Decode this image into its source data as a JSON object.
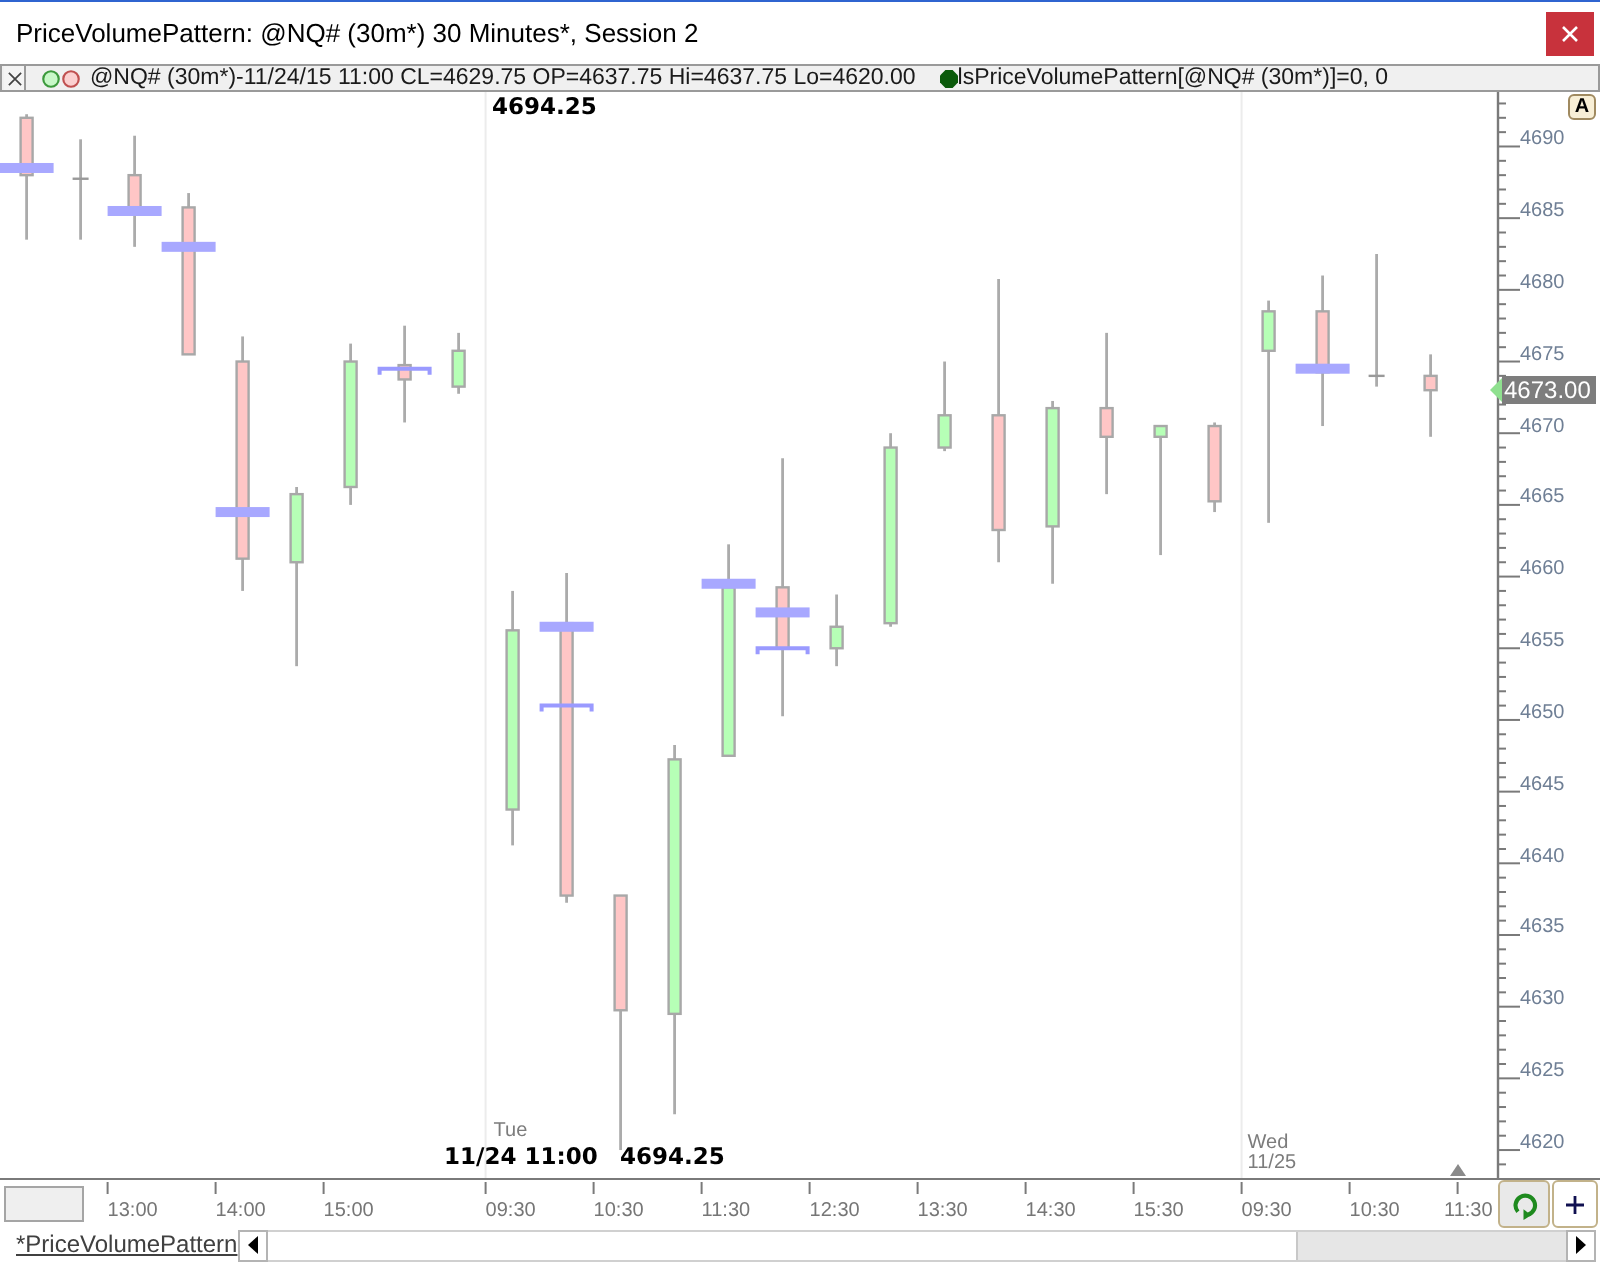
{
  "window": {
    "title": "PriceVolumePattern: @NQ# (30m*) 30 Minutes*, Session 2"
  },
  "data_bar": {
    "symbol_readout": "@NQ# (30m*)-11/24/15 11:00 CL=4629.75 OP=4637.75 Hi=4637.75 Lo=4620.00",
    "indicator_readout": "lsPriceVolumePattern[@NQ# (30m*)]=0, 0"
  },
  "chart": {
    "high_label": "4694.25",
    "cursor_time": "11/24 11:00",
    "cursor_price": "4694.25",
    "session_labels": [
      {
        "day": "Tue"
      },
      {
        "day": "Wed",
        "date": "11/25"
      }
    ],
    "last_price": "4673.00",
    "autoscale_button": "A",
    "chart_data": {
      "type": "candlestick",
      "categories": [
        null,
        null,
        "13:00",
        null,
        "14:00",
        null,
        "15:00",
        null,
        null,
        "09:30",
        null,
        "10:30",
        null,
        "11:30",
        null,
        "12:30",
        null,
        "13:30",
        null,
        "14:30",
        null,
        "15:30",
        null,
        "09:30",
        null,
        "10:30",
        null,
        "11:30"
      ],
      "ohlc": [
        [
          4692,
          4692.25,
          4683.5,
          4688
        ],
        [
          4687.75,
          4690.5,
          4683.5,
          4687.75
        ],
        [
          4688,
          4690.75,
          4683,
          4685.25
        ],
        [
          4685.75,
          4686.75,
          4675.5,
          4675.5
        ],
        [
          4675,
          4676.75,
          4659,
          4661.25
        ],
        [
          4661,
          4666.25,
          4653.75,
          4665.75
        ],
        [
          4666.25,
          4676.25,
          4665,
          4675
        ],
        [
          4674.75,
          4677.5,
          4670.75,
          4673.75
        ],
        [
          4673.25,
          4677,
          4672.75,
          4675.75
        ],
        [
          4643.75,
          4659,
          4641.25,
          4656.25
        ],
        [
          4656.75,
          4660.25,
          4637.25,
          4637.75
        ],
        [
          4637.75,
          4637.75,
          4620,
          4629.75
        ],
        [
          4629.5,
          4648.25,
          4622.5,
          4647.25
        ],
        [
          4647.5,
          4662.25,
          4647.5,
          4659.25
        ],
        [
          4659.25,
          4668.25,
          4650.25,
          4655
        ],
        [
          4655,
          4658.75,
          4653.75,
          4656.5
        ],
        [
          4656.75,
          4670,
          4656.5,
          4669
        ],
        [
          4669,
          4675,
          4668.75,
          4671.25
        ],
        [
          4671.25,
          4680.75,
          4661,
          4663.25
        ],
        [
          4663.5,
          4672.25,
          4659.5,
          4671.75
        ],
        [
          4671.75,
          4677,
          4665.75,
          4669.75
        ],
        [
          4669.75,
          4670.5,
          4661.5,
          4670.5
        ],
        [
          4670.5,
          4670.75,
          4664.5,
          4665.25
        ],
        [
          4675.75,
          4679.25,
          4663.75,
          4678.5
        ],
        [
          4678.5,
          4681,
          4670.5,
          4674.25
        ],
        [
          4674,
          4682.5,
          4673.25,
          4674
        ],
        [
          4674,
          4675.5,
          4669.75,
          4673
        ],
        null
      ],
      "ylim": [
        4618.05,
        4693.8
      ],
      "yticks": [
        4690,
        4685,
        4680,
        4675,
        4670,
        4665,
        4660,
        4655,
        4650,
        4645,
        4640,
        4635,
        4630,
        4625,
        4620
      ]
    }
  },
  "tabs": [
    {
      "label": "*PriceVolumePattern",
      "selected": true
    }
  ]
}
